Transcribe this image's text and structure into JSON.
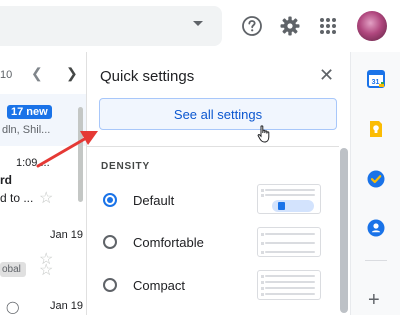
{
  "topbar": {
    "help_icon": "help-circle-icon",
    "settings_icon": "gear-icon",
    "apps_icon": "apps-grid-icon"
  },
  "list": {
    "pager_range": "10",
    "rows": [
      {
        "badge": "17 new",
        "snippet": "dln, Shil..."
      },
      {
        "time": "1:09 ...",
        "line1": "rd",
        "line2": "d to ..."
      },
      {
        "time": "Jan 19"
      },
      {
        "label": "obal"
      },
      {
        "time": "Jan 19"
      }
    ]
  },
  "quick_settings": {
    "title": "Quick settings",
    "see_all_label": "See all settings",
    "density_title": "DENSITY",
    "options": [
      {
        "label": "Default",
        "checked": true
      },
      {
        "label": "Comfortable",
        "checked": false
      },
      {
        "label": "Compact",
        "checked": false
      }
    ]
  },
  "side_panel": {
    "apps": [
      "calendar-icon",
      "keep-icon",
      "tasks-icon",
      "contacts-icon"
    ],
    "calendar_day": "31"
  },
  "colors": {
    "accent": "#1a73e8",
    "annotation_arrow": "#e53935",
    "button_bg": "#f1f6fe",
    "button_border": "#a8c7fa"
  }
}
